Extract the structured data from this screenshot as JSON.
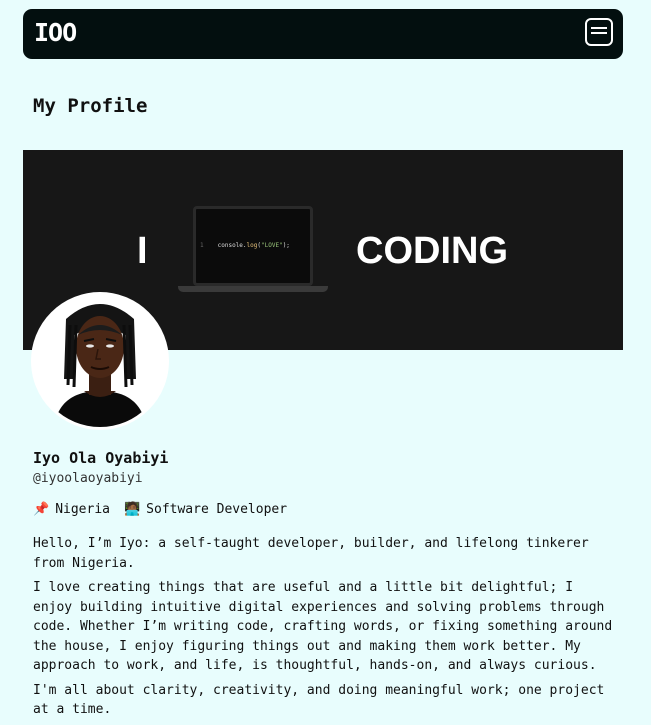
{
  "navbar": {
    "logo": "IOO",
    "menu_icon": "hamburger-menu-icon"
  },
  "page": {
    "title": "My Profile"
  },
  "banner": {
    "word_left": "I",
    "word_right": "CODING",
    "code_snippet": {
      "line_number": "1",
      "prefix": "console.",
      "function": "log",
      "open": "(",
      "string": "\"LOVE\"",
      "close": ");"
    },
    "image": "laptop-illustration"
  },
  "profile": {
    "avatar": "avatar-illustration",
    "name": "Iyo Ola Oyabiyi",
    "handle": "@iyoolaoyabiyi",
    "location": {
      "icon": "pin-icon",
      "glyph": "📌",
      "text": "Nigeria"
    },
    "occupation": {
      "icon": "laptop-developer-icon",
      "glyph": "🧑🏾‍💻",
      "text": "Software Developer"
    },
    "bio": [
      "Hello, I’m Iyo: a self-taught developer, builder, and lifelong tinkerer from Nigeria.",
      "I love creating things that are useful and a little bit delightful; I enjoy building intuitive digital experiences and solving problems through code. Whether I’m writing code, crafting words, or fixing something around the house, I enjoy figuring things out and making them work better. My approach to work, and life, is thoughtful, hands-on, and always curious.",
      "I'm all about clarity, creativity, and doing meaningful work; one project at a time."
    ]
  },
  "colors": {
    "background": "#e8fdfd",
    "navbar": "#030f0f",
    "banner": "#171717",
    "text": "#111111"
  }
}
